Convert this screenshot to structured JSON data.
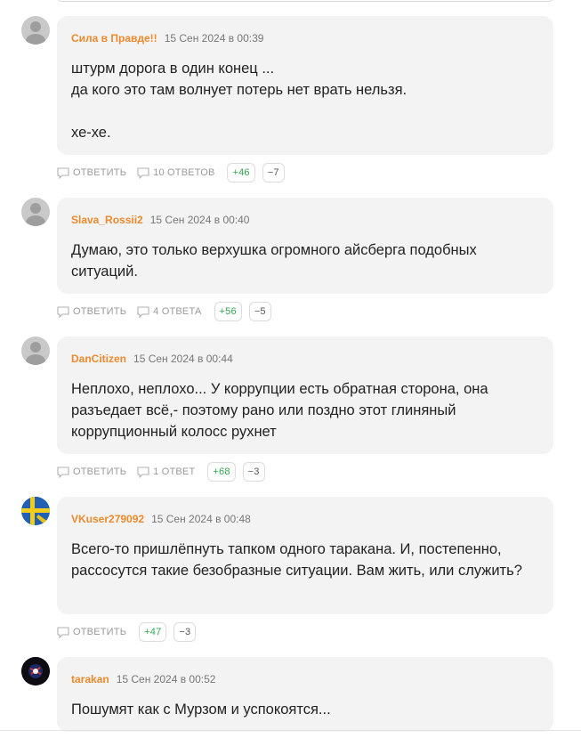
{
  "labels": {
    "reply": "ОТВЕТИТЬ"
  },
  "colors": {
    "author": "#ee8a2d",
    "plus": "#2fa84f",
    "bubble": "#f3f3f3"
  },
  "comments": [
    {
      "author": "Сила в Правде!!",
      "date": "15 Сен 2024 в 00:39",
      "text": "штурм дорога в один конец ...\nда кого это там волнует потерь нет врать нельзя.\n\nхе-хе.",
      "replies": "10 ОТВЕТОВ",
      "plus": "+46",
      "minus": "−7",
      "avatar": "default-user-icon"
    },
    {
      "author": "Slava_Rossii2",
      "date": "15 Сен 2024 в 00:40",
      "text": "Думаю, это только верхушка огромного айсберга подобных ситуаций.",
      "replies": "4 ОТВЕТА",
      "plus": "+56",
      "minus": "−5",
      "avatar": "default-user-icon"
    },
    {
      "author": "DanCitizen",
      "date": "15 Сен 2024 в 00:44",
      "text": "Неплохо, неплохо... У коррупции есть обратная сторона, она разъедает всё,- поэтому рано или поздно этот глиняный коррупционный колосс рухнет",
      "replies": "1 ОТВЕТ",
      "plus": "+68",
      "minus": "−3",
      "avatar": "default-user-icon"
    },
    {
      "author": "VKuser279092",
      "date": "15 Сен 2024 в 00:48",
      "text": "Всего-то пришлёпнуть тапком одного таракана. И, постепенно, рассосутся такие безобразные ситуации. Вам жить, или служить?",
      "replies": "",
      "plus": "+47",
      "minus": "−3",
      "avatar": "flag-avatar-icon"
    },
    {
      "author": "tarakan",
      "date": "15 Сен 2024 в 00:52",
      "text": "Пошумят как с Мурзом и успокоятся...",
      "avatar": "logo-avatar-icon"
    }
  ]
}
